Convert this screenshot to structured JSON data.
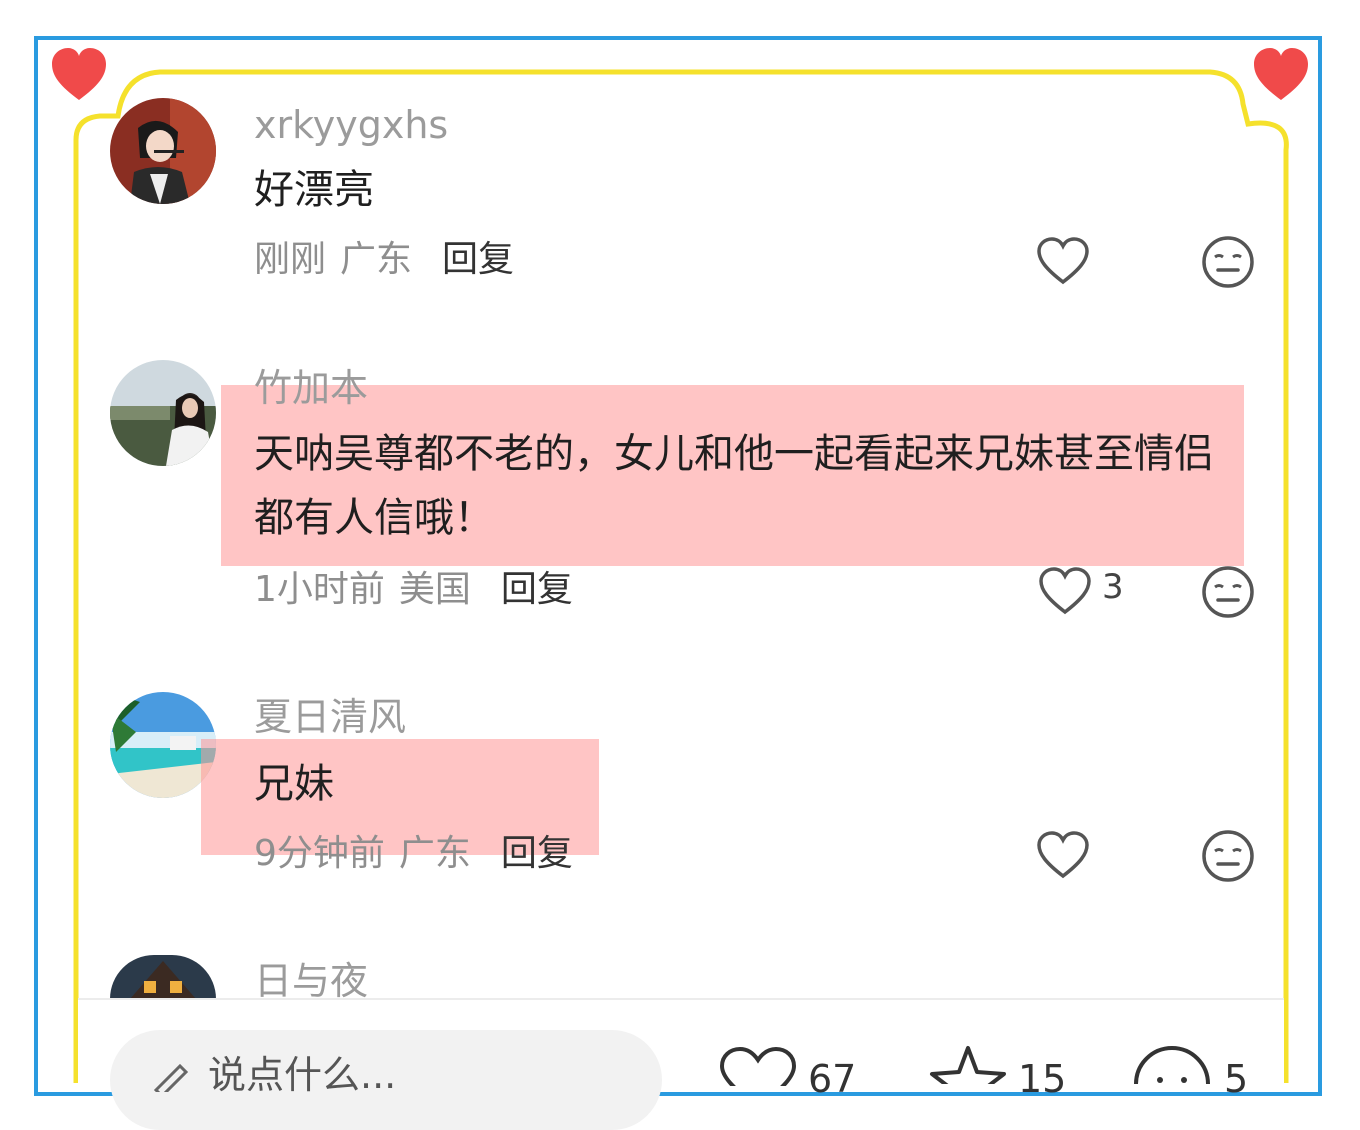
{
  "colors": {
    "frame_blue": "#2a9be0",
    "frame_yellow": "#f5e12c",
    "heart_red": "#f04a4a",
    "highlight": "#ffb3b3"
  },
  "comments": [
    {
      "username": "xrkyygxhs",
      "text": "好漂亮",
      "time": "刚刚",
      "location": "广东",
      "reply": "回复",
      "likes": ""
    },
    {
      "username": "竹加本",
      "text": "天呐吴尊都不老的，女儿和他一起看起来兄妹甚至情侣都有人信哦！",
      "time": "1小时前",
      "location": "美国",
      "reply": "回复",
      "likes": "3"
    },
    {
      "username": "夏日清风",
      "text": "兄妹",
      "time": "9分钟前",
      "location": "广东",
      "reply": "回复",
      "likes": ""
    },
    {
      "username": "日与夜"
    }
  ],
  "bottom_bar": {
    "input_placeholder": "说点什么...",
    "like_count": "67",
    "star_count": "15",
    "comment_count": "5"
  },
  "icons": [
    "heart-icon",
    "emoji-icon",
    "pencil-icon",
    "star-icon",
    "comment-icon"
  ]
}
